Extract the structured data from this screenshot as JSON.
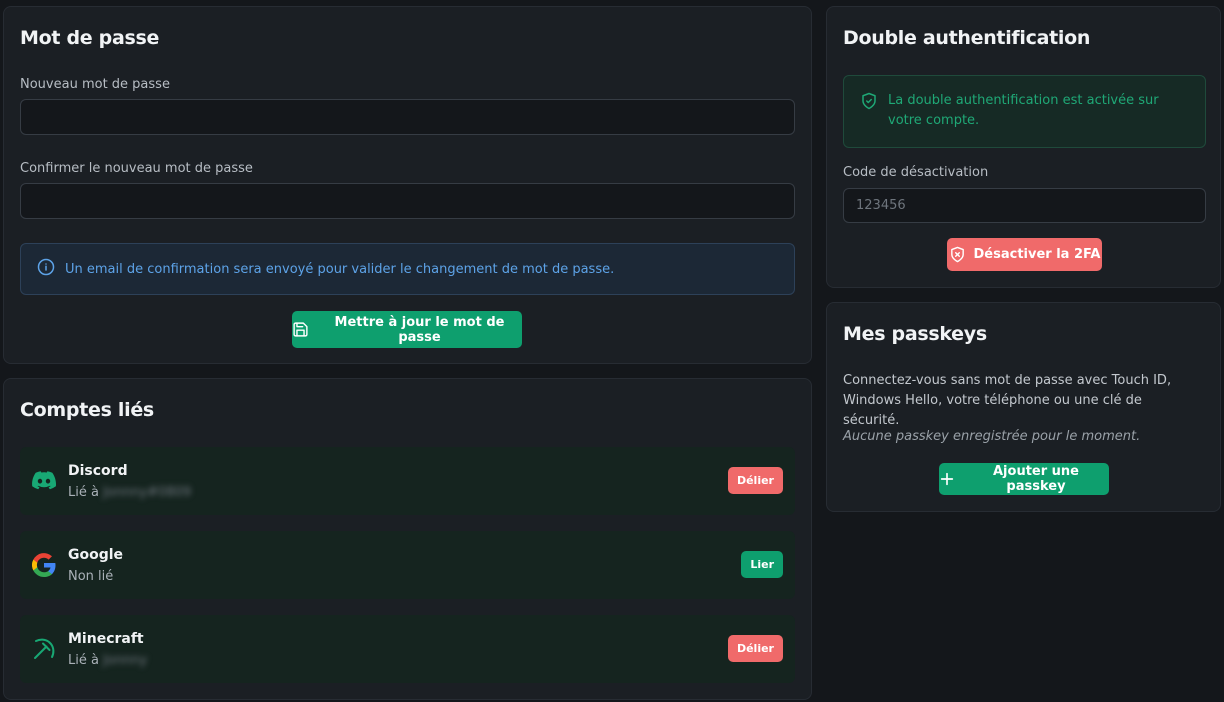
{
  "password": {
    "title": "Mot de passe",
    "new_label": "Nouveau mot de passe",
    "new_value": "",
    "confirm_label": "Confirmer le nouveau mot de passe",
    "confirm_value": "",
    "info_text": "Un email de confirmation sera envoyé pour valider le changement de mot de passe.",
    "update_button": "Mettre à jour le mot de passe"
  },
  "linked": {
    "title": "Comptes liés",
    "accounts": [
      {
        "name": "Discord",
        "status": "Lié à",
        "username": "Jonnny#0809",
        "action": "Délier",
        "icon": "discord-icon"
      },
      {
        "name": "Google",
        "status": "Non lié",
        "username": "",
        "action": "Lier",
        "icon": "google-icon"
      },
      {
        "name": "Minecraft",
        "status": "Lié à",
        "username": "Jonnny",
        "action": "Délier",
        "icon": "pickaxe-icon"
      }
    ]
  },
  "twofa": {
    "title": "Double authentification",
    "status_text": "La double authentification est activée sur votre compte.",
    "code_label": "Code de désactivation",
    "code_placeholder": "123456",
    "code_value": "",
    "disable_button": "Désactiver la 2FA"
  },
  "passkeys": {
    "title": "Mes passkeys",
    "description": "Connectez-vous sans mot de passe avec Touch ID, Windows Hello, votre téléphone ou une clé de sécurité.",
    "empty_text": "Aucune passkey enregistrée pour le moment.",
    "add_button": "Ajouter une passkey"
  },
  "colors": {
    "background": "#14171b",
    "card": "#1b1f24",
    "accent_green": "#0e9f6e",
    "danger_red": "#f06a6a",
    "info_blue": "#5da3e8"
  }
}
